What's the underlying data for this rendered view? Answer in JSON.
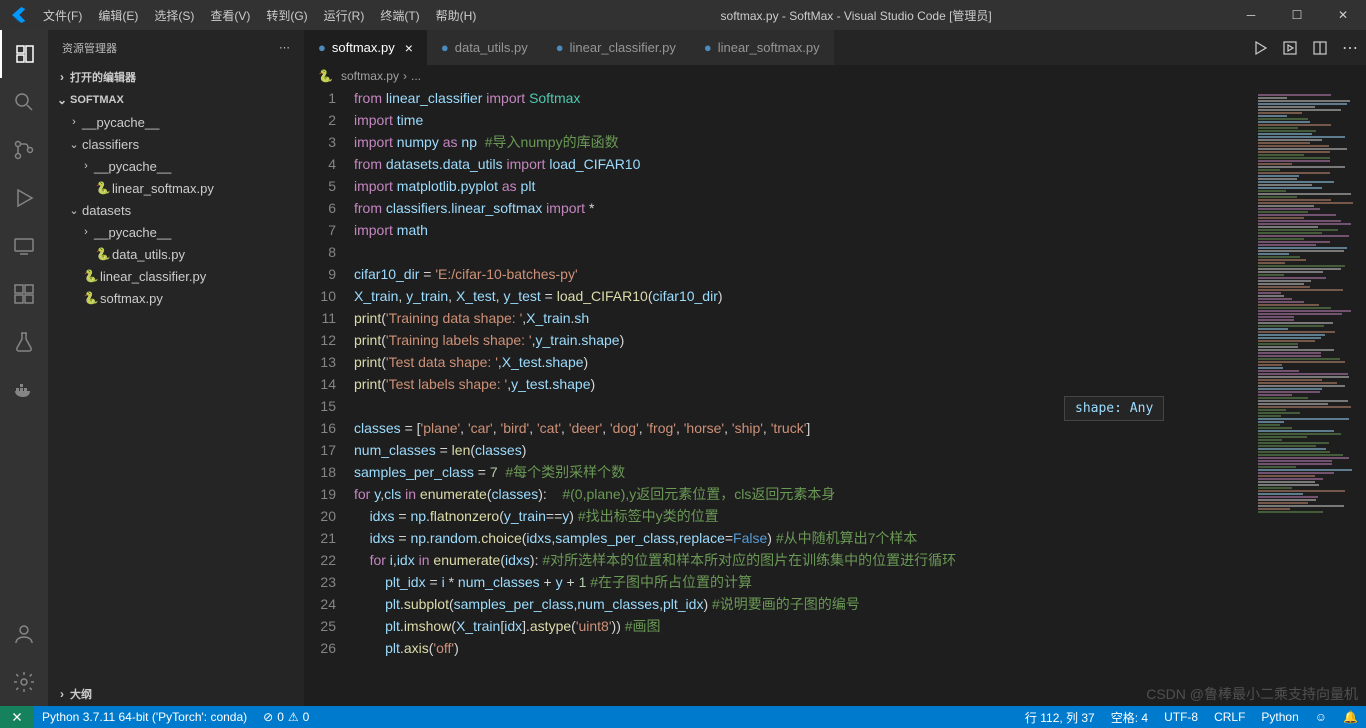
{
  "window": {
    "title": "softmax.py - SoftMax - Visual Studio Code [管理员]"
  },
  "menu": {
    "file": "文件(F)",
    "edit": "编辑(E)",
    "select": "选择(S)",
    "view": "查看(V)",
    "go": "转到(G)",
    "run": "运行(R)",
    "terminal": "终端(T)",
    "help": "帮助(H)"
  },
  "sidebar": {
    "title": "资源管理器",
    "openEditors": "打开的编辑器",
    "folder": "SOFTMAX",
    "outline": "大纲",
    "tree": [
      {
        "d": 1,
        "type": "folder",
        "open": false,
        "name": "__pycache__"
      },
      {
        "d": 1,
        "type": "folder",
        "open": true,
        "name": "classifiers"
      },
      {
        "d": 2,
        "type": "folder",
        "open": false,
        "name": "__pycache__"
      },
      {
        "d": 2,
        "type": "file",
        "name": "linear_softmax.py"
      },
      {
        "d": 1,
        "type": "folder",
        "open": true,
        "name": "datasets"
      },
      {
        "d": 2,
        "type": "folder",
        "open": false,
        "name": "__pycache__"
      },
      {
        "d": 2,
        "type": "file",
        "name": "data_utils.py"
      },
      {
        "d": 1,
        "type": "file",
        "name": "linear_classifier.py"
      },
      {
        "d": 1,
        "type": "file",
        "name": "softmax.py"
      }
    ]
  },
  "tabs": [
    {
      "name": "softmax.py",
      "dirty": true,
      "active": true
    },
    {
      "name": "data_utils.py",
      "dirty": true,
      "active": false
    },
    {
      "name": "linear_classifier.py",
      "dirty": true,
      "active": false
    },
    {
      "name": "linear_softmax.py",
      "dirty": true,
      "active": false
    }
  ],
  "breadcrumbs": {
    "file": "softmax.py",
    "rest": "..."
  },
  "hover": {
    "text": "shape: Any"
  },
  "code": [
    {
      "n": 1,
      "h": "<span class='kw'>from</span> <span class='var'>linear_classifier</span> <span class='kw'>import</span> <span class='cls'>Softmax</span>"
    },
    {
      "n": 2,
      "h": "<span class='kw'>import</span> <span class='var'>time</span>"
    },
    {
      "n": 3,
      "h": "<span class='kw'>import</span> <span class='var'>numpy</span> <span class='kw'>as</span> <span class='var'>np</span>  <span class='cmt'>#导入numpy的库函数</span>"
    },
    {
      "n": 4,
      "h": "<span class='kw'>from</span> <span class='var'>datasets.data_utils</span> <span class='kw'>import</span> <span class='var'>load_CIFAR10</span>"
    },
    {
      "n": 5,
      "h": "<span class='kw'>import</span> <span class='var'>matplotlib.pyplot</span> <span class='kw'>as</span> <span class='var'>plt</span>"
    },
    {
      "n": 6,
      "h": "<span class='kw'>from</span> <span class='var'>classifiers.linear_softmax</span> <span class='kw'>import</span> *"
    },
    {
      "n": 7,
      "h": "<span class='kw'>import</span> <span class='var'>math</span>"
    },
    {
      "n": 8,
      "h": ""
    },
    {
      "n": 9,
      "h": "<span class='var'>cifar10_dir</span> = <span class='str'>'E:/cifar-10-batches-py'</span>"
    },
    {
      "n": 10,
      "h": "<span class='var'>X_train</span>, <span class='var'>y_train</span>, <span class='var'>X_test</span>, <span class='var'>y_test</span> = <span class='fn'>load_CIFAR10</span>(<span class='var'>cifar10_dir</span>)"
    },
    {
      "n": 11,
      "h": "<span class='fn'>print</span>(<span class='str'>'Training data shape: '</span>,<span class='var'>X_train</span>.<span class='var'>sh</span>"
    },
    {
      "n": 12,
      "h": "<span class='fn'>print</span>(<span class='str'>'Training labels shape: '</span>,<span class='var'>y_train</span>.<span class='var'>shape</span>)"
    },
    {
      "n": 13,
      "h": "<span class='fn'>print</span>(<span class='str'>'Test data shape: '</span>,<span class='var'>X_test</span>.<span class='var'>shape</span>)"
    },
    {
      "n": 14,
      "h": "<span class='fn'>print</span>(<span class='str'>'Test labels shape: '</span>,<span class='var'>y_test</span>.<span class='var'>shape</span>)"
    },
    {
      "n": 15,
      "h": ""
    },
    {
      "n": 16,
      "h": "<span class='var'>classes</span> = [<span class='str'>'plane'</span>, <span class='str'>'car'</span>, <span class='str'>'bird'</span>, <span class='str'>'cat'</span>, <span class='str'>'deer'</span>, <span class='str'>'dog'</span>, <span class='str'>'frog'</span>, <span class='str'>'horse'</span>, <span class='str'>'ship'</span>, <span class='str'>'truck'</span>]"
    },
    {
      "n": 17,
      "h": "<span class='var'>num_classes</span> = <span class='fn'>len</span>(<span class='var'>classes</span>)"
    },
    {
      "n": 18,
      "h": "<span class='var'>samples_per_class</span> = <span class='num'>7</span>  <span class='cmt'>#每个类别采样个数</span>"
    },
    {
      "n": 19,
      "h": "<span class='kw'>for</span> <span class='var'>y</span>,<span class='var'>cls</span> <span class='kw'>in</span> <span class='fn'>enumerate</span>(<span class='var'>classes</span>):    <span class='cmt'>#(0,plane),y返回元素位置，cls返回元素本身</span>"
    },
    {
      "n": 20,
      "h": "    <span class='var'>idxs</span> = <span class='var'>np</span>.<span class='fn'>flatnonzero</span>(<span class='var'>y_train</span>==<span class='var'>y</span>) <span class='cmt'>#找出标签中y类的位置</span>"
    },
    {
      "n": 21,
      "h": "    <span class='var'>idxs</span> = <span class='var'>np</span>.<span class='var'>random</span>.<span class='fn'>choice</span>(<span class='var'>idxs</span>,<span class='var'>samples_per_class</span>,<span class='var'>replace</span>=<span class='const'>False</span>) <span class='cmt'>#从中随机算出7个样本</span>"
    },
    {
      "n": 22,
      "h": "    <span class='kw'>for</span> <span class='var'>i</span>,<span class='var'>idx</span> <span class='kw'>in</span> <span class='fn'>enumerate</span>(<span class='var'>idxs</span>): <span class='cmt'>#对所选样本的位置和样本所对应的图片在训练集中的位置进行循环</span>"
    },
    {
      "n": 23,
      "h": "        <span class='var'>plt_idx</span> = <span class='var'>i</span> * <span class='var'>num_classes</span> + <span class='var'>y</span> + <span class='num'>1</span> <span class='cmt'>#在子图中所占位置的计算</span>"
    },
    {
      "n": 24,
      "h": "        <span class='var'>plt</span>.<span class='fn'>subplot</span>(<span class='var'>samples_per_class</span>,<span class='var'>num_classes</span>,<span class='var'>plt_idx</span>) <span class='cmt'>#说明要画的子图的编号</span>"
    },
    {
      "n": 25,
      "h": "        <span class='var'>plt</span>.<span class='fn'>imshow</span>(<span class='var'>X_train</span>[<span class='var'>idx</span>].<span class='fn'>astype</span>(<span class='str'>'uint8'</span>)) <span class='cmt'>#画图</span>"
    },
    {
      "n": 26,
      "h": "        <span class='var'>plt</span>.<span class='fn'>axis</span>(<span class='str'>'off'</span>)"
    }
  ],
  "status": {
    "interpreter": "Python 3.7.11 64-bit ('PyTorch': conda)",
    "errors": "0",
    "warnings": "0",
    "ln": "行 112, 列 37",
    "spaces": "空格: 4",
    "enc": "UTF-8",
    "eol": "CRLF",
    "lang": "Python"
  },
  "watermark": "CSDN @鲁棒最小二乘支持向量机"
}
